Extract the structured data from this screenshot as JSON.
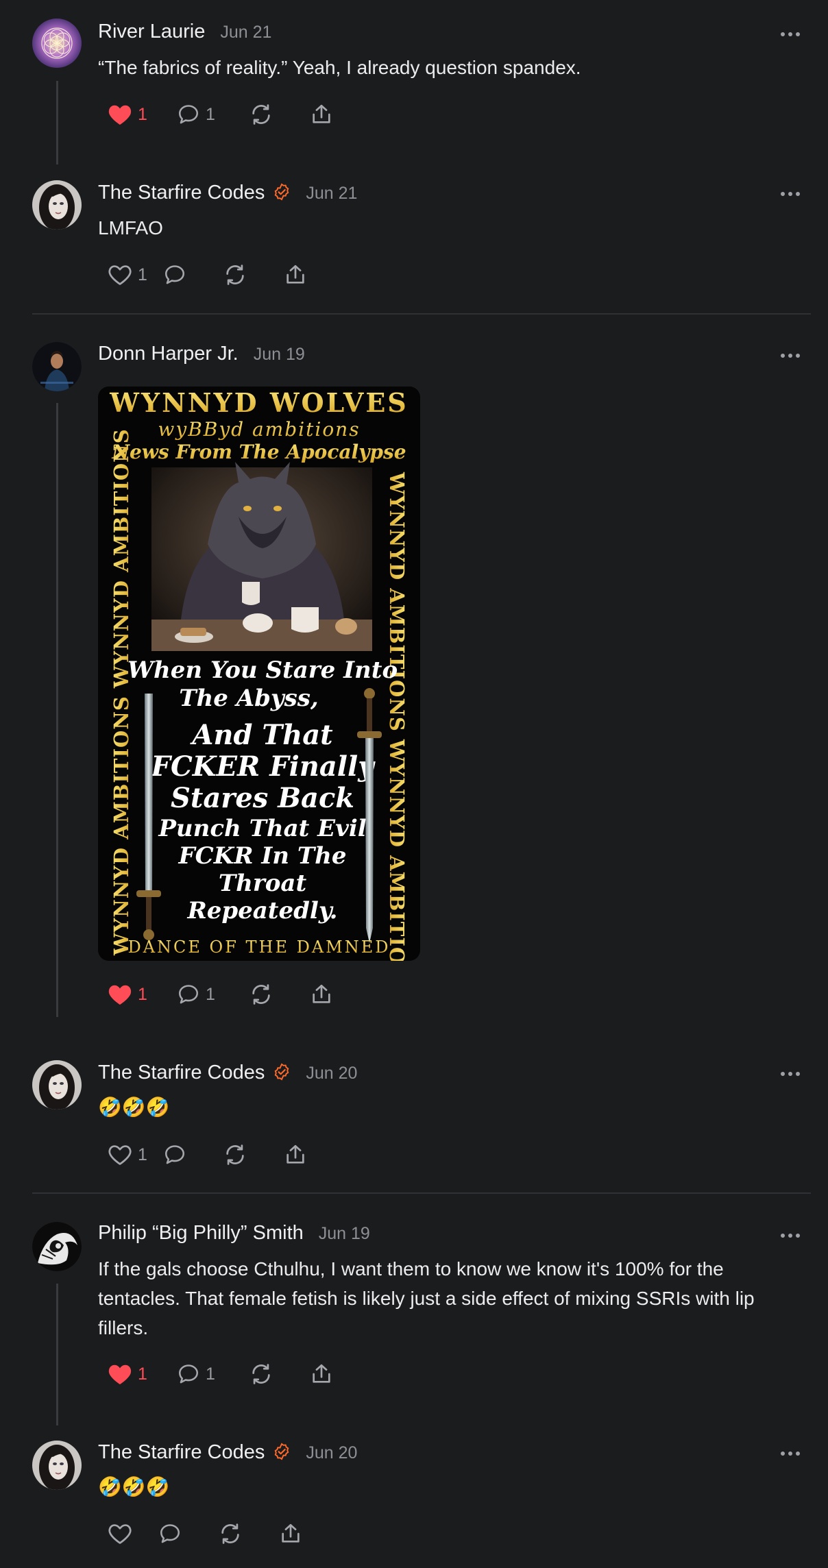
{
  "posts": [
    {
      "author": "River Laurie",
      "date": "Jun 21",
      "text": "“The fabrics of reality.” Yeah, I already question spandex.",
      "liked": true,
      "likes": "1",
      "replies": "1"
    },
    {
      "author": "The Starfire Codes",
      "verified": true,
      "date": "Jun 21",
      "text": "LMFAO",
      "liked": false,
      "likes": "1",
      "replies": ""
    },
    {
      "author": "Donn Harper Jr.",
      "date": "Jun 19",
      "liked": true,
      "likes": "1",
      "replies": "1",
      "image": {
        "header_1": "WYNNYD  WOLVES",
        "header_2": "wyBByd  ambitions",
        "header_3": "News From The Apocalypse",
        "side_text": "WYNNYD AMBITIONS  WYNNYD AMBITIONS",
        "line_1": "When You Stare Into",
        "line_2": "The Abyss,",
        "line_3": "And That",
        "line_4": "FCKER Finally",
        "line_5": "Stares Back",
        "line_6": "Punch That Evil",
        "line_7": "FCKR In The",
        "line_8": "Throat",
        "line_9": "Repeatedly.",
        "footer": "DANCE OF THE DAMNED"
      }
    },
    {
      "author": "The Starfire Codes",
      "verified": true,
      "date": "Jun 20",
      "text": "🤣🤣🤣",
      "liked": false,
      "likes": "1",
      "replies": ""
    },
    {
      "author": "Philip “Big Philly” Smith",
      "date": "Jun 19",
      "text": "If the gals choose Cthulhu, I want them to know we know it's 100% for the tentacles. That female fetish is likely just a side effect of mixing SSRIs with lip fillers.",
      "liked": true,
      "likes": "1",
      "replies": "1"
    },
    {
      "author": "The Starfire Codes",
      "verified": true,
      "date": "Jun 20",
      "text": "🤣🤣🤣",
      "liked": false,
      "likes": "",
      "replies": ""
    }
  ],
  "colors": {
    "background": "#1b1c1e",
    "like_red": "#ff4d57",
    "verified_orange": "#ff6a2b",
    "muted": "#8e8f94",
    "poster_yellow": "#f3d34a"
  },
  "icons": [
    "heart-icon",
    "comment-icon",
    "repost-icon",
    "share-icon",
    "more-icon",
    "verified-icon"
  ]
}
